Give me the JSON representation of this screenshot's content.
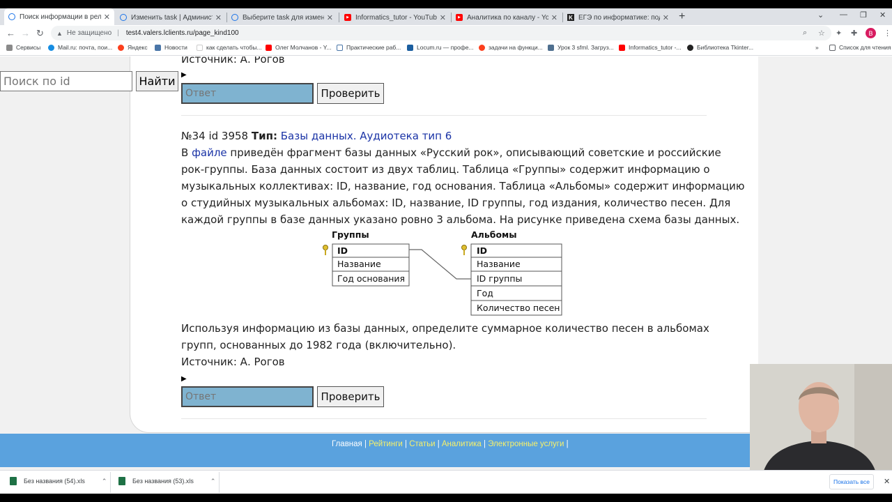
{
  "tabs": [
    {
      "label": "Поиск информации в реляцион",
      "icon": "globe-icon"
    },
    {
      "label": "Изменить task | Администрати",
      "icon": "globe-icon"
    },
    {
      "label": "Выберите task для изменения |",
      "icon": "globe-icon"
    },
    {
      "label": "Informatics_tutor - YouTube",
      "icon": "youtube-icon"
    },
    {
      "label": "Аналитика по каналу - YouTube",
      "icon": "youtube-icon"
    },
    {
      "label": "ЕГЭ по информатике: подготов",
      "icon": "k-icon"
    }
  ],
  "address": {
    "security": "Не защищено",
    "url": "test4.valers.lclients.ru/page_kind100"
  },
  "profile_initial": "B",
  "bookmarks": [
    "Сервисы",
    "Mail.ru: почта, пои...",
    "Яндекс",
    "Новости",
    "как сделать чтобы...",
    "Олег Молчанов - Y...",
    "Практические раб...",
    "Locum.ru — профе...",
    "задачи на функци...",
    "Урок 3 sfml. Загруз...",
    "Informatics_tutor -...",
    "Библиотека Tkinter..."
  ],
  "bookmarks_more": "»",
  "reading_list": "Список для чтения",
  "search": {
    "placeholder": "Поиск по id",
    "button": "Найти"
  },
  "prev_task": {
    "source": "Источник: А. Рогов"
  },
  "answer_placeholder": "Ответ",
  "check_label": "Проверить",
  "task": {
    "number": "№34 id 3958",
    "type_label": "Тип:",
    "type_value": "Базы данных. Аудиотека тип 6",
    "lines": [
      [
        "В ",
        "файле",
        " приведён фрагмент базы данных «Русский рок», описывающий советские и российские"
      ],
      "рок-группы. База данных состоит из двух таблиц. Таблица «Группы» содержит информацию о",
      "музыкальных коллективах: ID, название, год основания. Таблица «Альбомы» содержит информацию",
      "о студийных музыкальных альбомах: ID, название, ID группы, год издания, количество песен. Для",
      "каждой группы в базе данных указано ровно 3 альбома. На рисунке приведена схема базы данных."
    ],
    "question_lines": [
      "Используя информацию из базы данных, определите суммарное количество песен в альбомах",
      "групп, основанных до 1982 года (включительно)."
    ],
    "source": "Источник: А. Рогов"
  },
  "schema": {
    "groups": {
      "title": "Группы",
      "fields": [
        "ID",
        "Название",
        "Год основания"
      ]
    },
    "albums": {
      "title": "Альбомы",
      "fields": [
        "ID",
        "Название",
        "ID группы",
        "Год",
        "Количество песен"
      ]
    }
  },
  "footer": {
    "links": [
      "Главная",
      "Рейтинги",
      "Статьи",
      "Аналитика",
      "Электронные услуги"
    ]
  },
  "downloads": [
    {
      "name": "Без названия (54).xls"
    },
    {
      "name": "Без названия (53).xls"
    }
  ],
  "show_all": "Показать все"
}
